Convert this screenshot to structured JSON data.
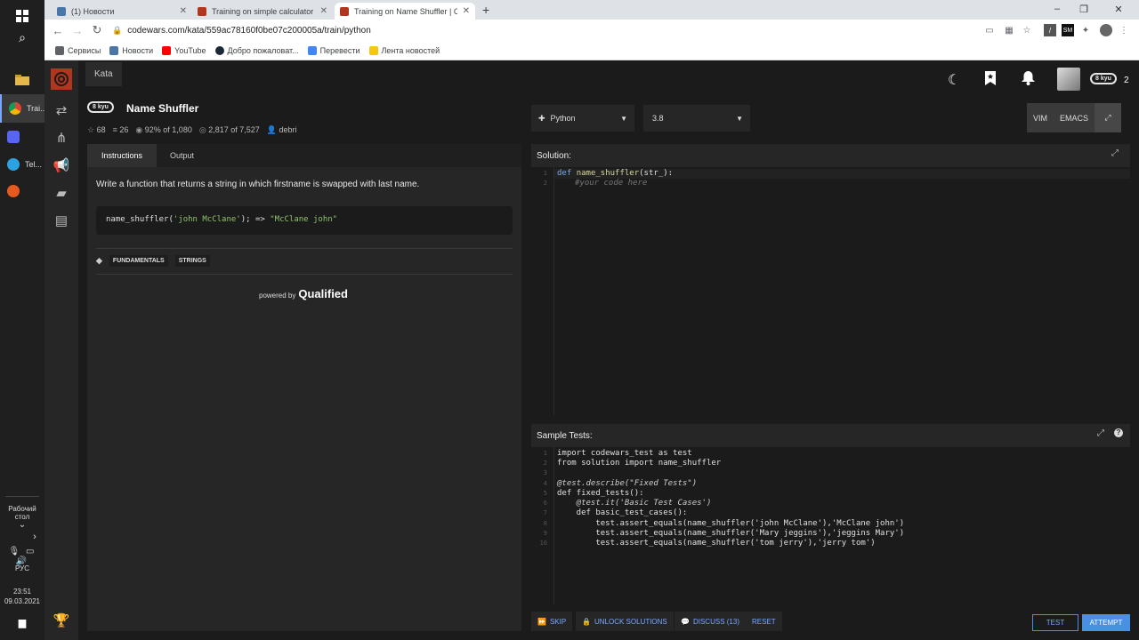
{
  "taskbar": {
    "apps": [
      {
        "label": "Trai...",
        "color": "#e8453c"
      },
      {
        "label": "",
        "color": "#5865f2"
      },
      {
        "label": "Tel...",
        "color": "#2aa3e0"
      },
      {
        "label": "",
        "color": "#e65a1f"
      }
    ],
    "desktop_label": "Рабочий стол",
    "lang": "РУС",
    "time": "23:51",
    "date": "09.03.2021"
  },
  "browser": {
    "tabs": [
      {
        "title": "(1) Новости",
        "fav_color": "#4a76a8"
      },
      {
        "title": "Training on simple calculator | Co",
        "fav_color": "#b1361e"
      },
      {
        "title": "Training on Name Shuffler | Code",
        "fav_color": "#b1361e"
      }
    ],
    "new_tab": "+",
    "url": "codewars.com/kata/559ac78160f0be07c200005a/train/python",
    "bookmarks": [
      {
        "label": "Сервисы",
        "color": "#5f6368"
      },
      {
        "label": "Новости",
        "color": "#4a76a8"
      },
      {
        "label": "YouTube",
        "color": "#ff0000"
      },
      {
        "label": "Добро пожаловат...",
        "color": "#1b2838"
      },
      {
        "label": "Перевести",
        "color": "#4285f4"
      },
      {
        "label": "Лента новостей",
        "color": "#f5c518"
      }
    ]
  },
  "app": {
    "kata_tab": "Kata",
    "user_kyu": "8 kyu",
    "user_honor": "2",
    "kata": {
      "kyu": "8 kyu",
      "title": "Name Shuffler",
      "stars": "68",
      "collections": "26",
      "satisfaction": "92% of 1,080",
      "completed": "2,817 of 7,527",
      "author": "debri"
    },
    "panel_tabs": [
      "Instructions",
      "Output"
    ],
    "description": "Write a function that returns a string in which firstname is swapped with last name.",
    "example": {
      "fn": "name_shuffler(",
      "arg": "'john McClane'",
      "mid": "); => ",
      "result": "\"McClane john\""
    },
    "tags": [
      "FUNDAMENTALS",
      "STRINGS"
    ],
    "powered_by": "powered by",
    "qualified": "Qualified",
    "language": "Python",
    "version": "3.8",
    "modes": [
      "VIM",
      "EMACS"
    ],
    "solution_label": "Solution:",
    "solution_code": {
      "line1_kw": "def ",
      "line1_fn": "name_shuffler",
      "line1_rest": "(str_):",
      "line2": "#your code here"
    },
    "tests_label": "Sample Tests:",
    "tests_code": [
      "import codewars_test as test",
      "from solution import name_shuffler",
      "",
      "@test.describe(\"Fixed Tests\")",
      "def fixed_tests():",
      "    @test.it('Basic Test Cases')",
      "    def basic_test_cases():",
      "        test.assert_equals(name_shuffler('john McClane'),'McClane john')",
      "        test.assert_equals(name_shuffler('Mary jeggins'),'jeggins Mary')",
      "        test.assert_equals(name_shuffler('tom jerry'),'jerry tom')"
    ],
    "buttons": {
      "skip": "SKIP",
      "unlock": "UNLOCK SOLUTIONS",
      "discuss": "DISCUSS (13)",
      "reset": "RESET",
      "test": "TEST",
      "attempt": "ATTEMPT"
    },
    "colors": {
      "accent": "#4a90e2",
      "brand": "#b1361e"
    }
  }
}
